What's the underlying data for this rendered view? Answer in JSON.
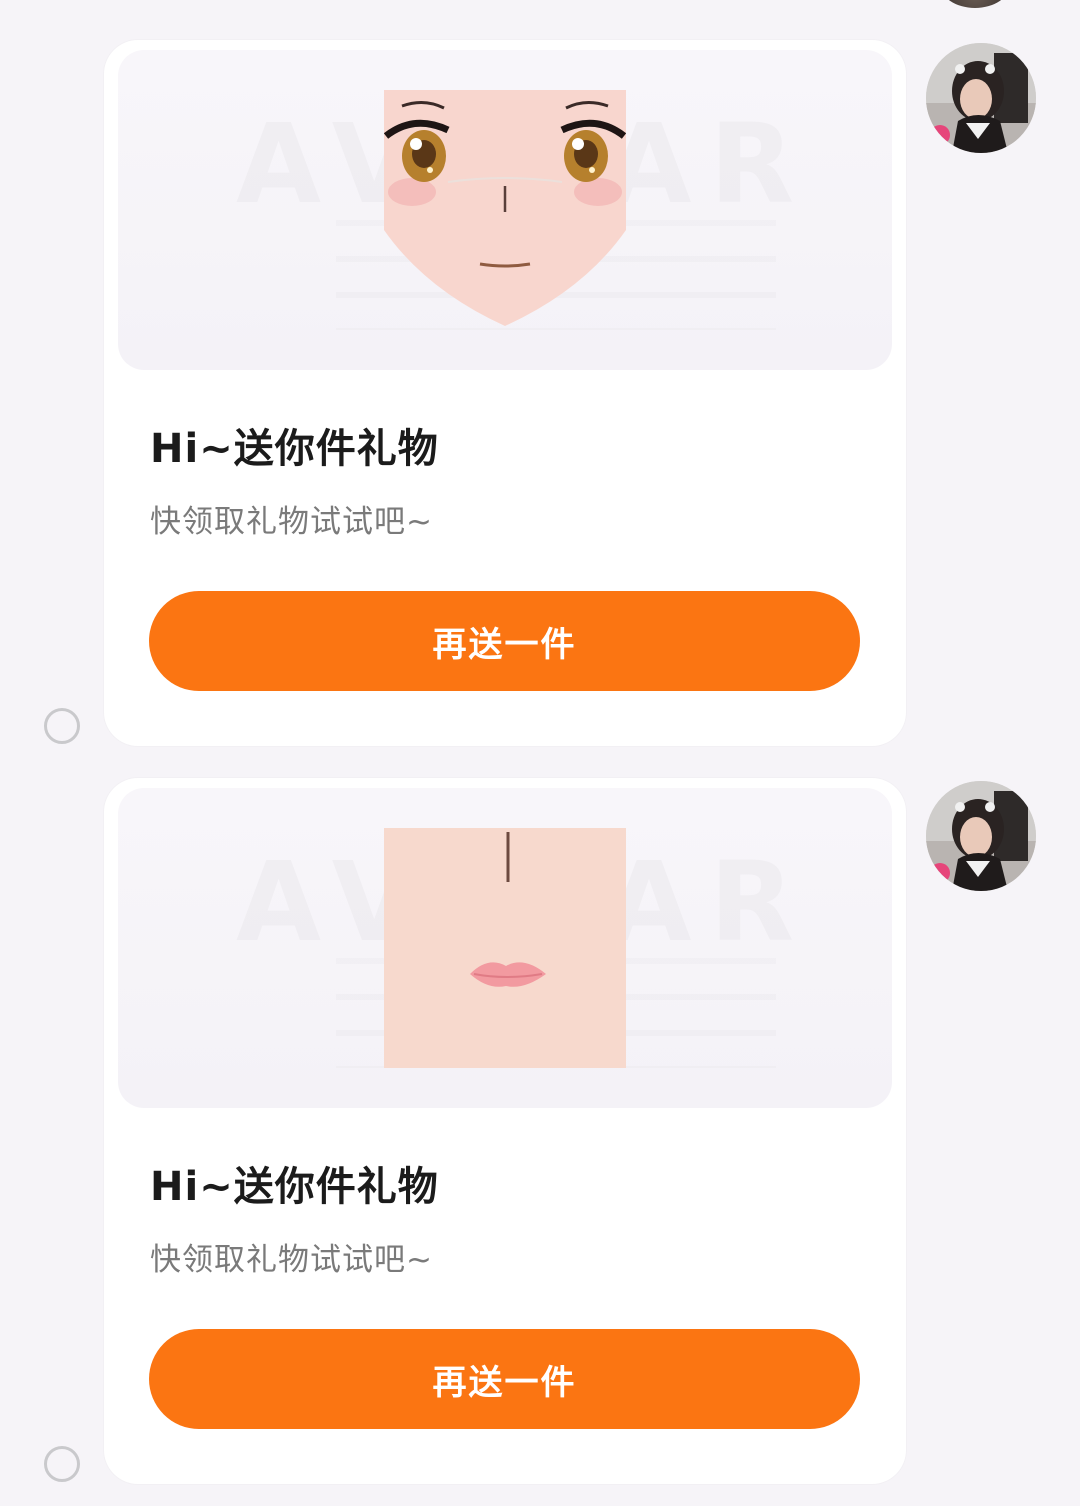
{
  "colors": {
    "background": "#f6f4f8",
    "card": "#ffffff",
    "accent": "#fb7512",
    "title": "#1b1b1b",
    "subtitle": "#7a7a7a"
  },
  "messages": [
    {
      "title": "Hi~送你件礼物",
      "subtitle": "快领取礼物试试吧~",
      "button_label": "再送一件",
      "item_icon": "anime-face-eyes-icon",
      "avatar_icon": "user-avatar-photo"
    },
    {
      "title": "Hi~送你件礼物",
      "subtitle": "快领取礼物试试吧~",
      "button_label": "再送一件",
      "item_icon": "anime-face-mouth-icon",
      "avatar_icon": "user-avatar-photo"
    }
  ]
}
